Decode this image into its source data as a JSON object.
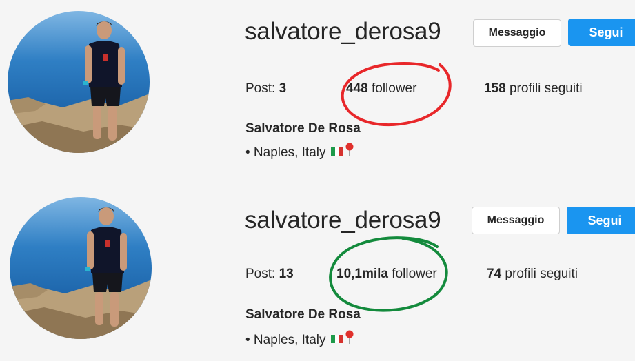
{
  "profiles": [
    {
      "username": "salvatore_derosa9",
      "message_label": "Messaggio",
      "follow_label": "Segui",
      "posts_label": "Post:",
      "posts_count": "3",
      "followers_count": "448",
      "followers_label": "follower",
      "following_count": "158",
      "following_label": "profili seguiti",
      "full_name": "Salvatore De Rosa",
      "bio": "• Naples, Italy",
      "highlight_color": "#e8272a"
    },
    {
      "username": "salvatore_derosa9",
      "message_label": "Messaggio",
      "follow_label": "Segui",
      "posts_label": "Post:",
      "posts_count": "13",
      "followers_count": "10,1mila",
      "followers_label": "follower",
      "following_count": "74",
      "following_label": "profili seguiti",
      "full_name": "Salvatore De Rosa",
      "bio": "• Naples, Italy",
      "highlight_color": "#138a3c"
    }
  ],
  "colors": {
    "follow_button": "#1a95f0",
    "background": "#f5f5f5"
  },
  "icons": [
    "italy-flag-icon",
    "round-pushpin-icon"
  ]
}
